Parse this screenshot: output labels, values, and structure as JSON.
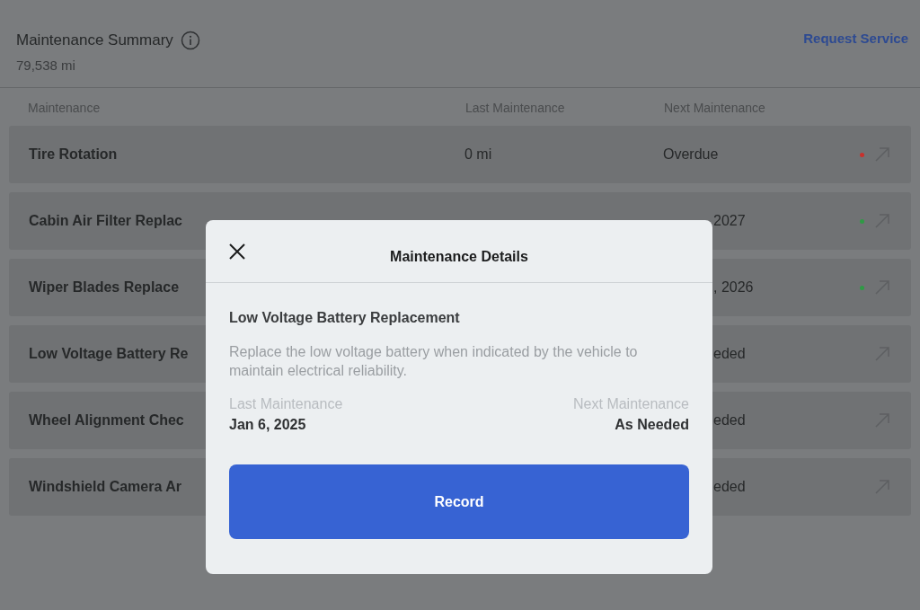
{
  "header": {
    "title": "Maintenance Summary",
    "odometer": "79,538  mi",
    "link": "Request Service"
  },
  "table": {
    "columns": [
      "Maintenance",
      "Last Maintenance",
      "Next Maintenance"
    ],
    "rows": [
      {
        "name": "Tire Rotation",
        "last": "0 mi",
        "next": "Overdue",
        "color": "#c8302c",
        "partly_hidden": false
      },
      {
        "name": "Cabin Air Filter Replac",
        "next": "2027",
        "color": "#2f9a45",
        "partly_hidden": true
      },
      {
        "name": "Wiper Blades Replace",
        "next": ", 2026",
        "color": "#2f9a45",
        "partly_hidden": true
      },
      {
        "name": "Low Voltage Battery Re",
        "next": "eded",
        "partly_hidden": true
      },
      {
        "name": "Wheel Alignment Chec",
        "next": "eded",
        "partly_hidden": true
      },
      {
        "name": "Windshield Camera Ar",
        "next": "eded",
        "partly_hidden": true
      }
    ]
  },
  "dialog": {
    "title": "Maintenance Details",
    "item": "Low Voltage Battery Replacement",
    "description": "Replace the low voltage battery when indicated by the vehicle to maintain electrical reliability.",
    "last_label": "Last Maintenance",
    "last_value": "Jan 6, 2025",
    "next_label": "Next Maintenance",
    "next_value": "As Needed",
    "button": "Record"
  }
}
